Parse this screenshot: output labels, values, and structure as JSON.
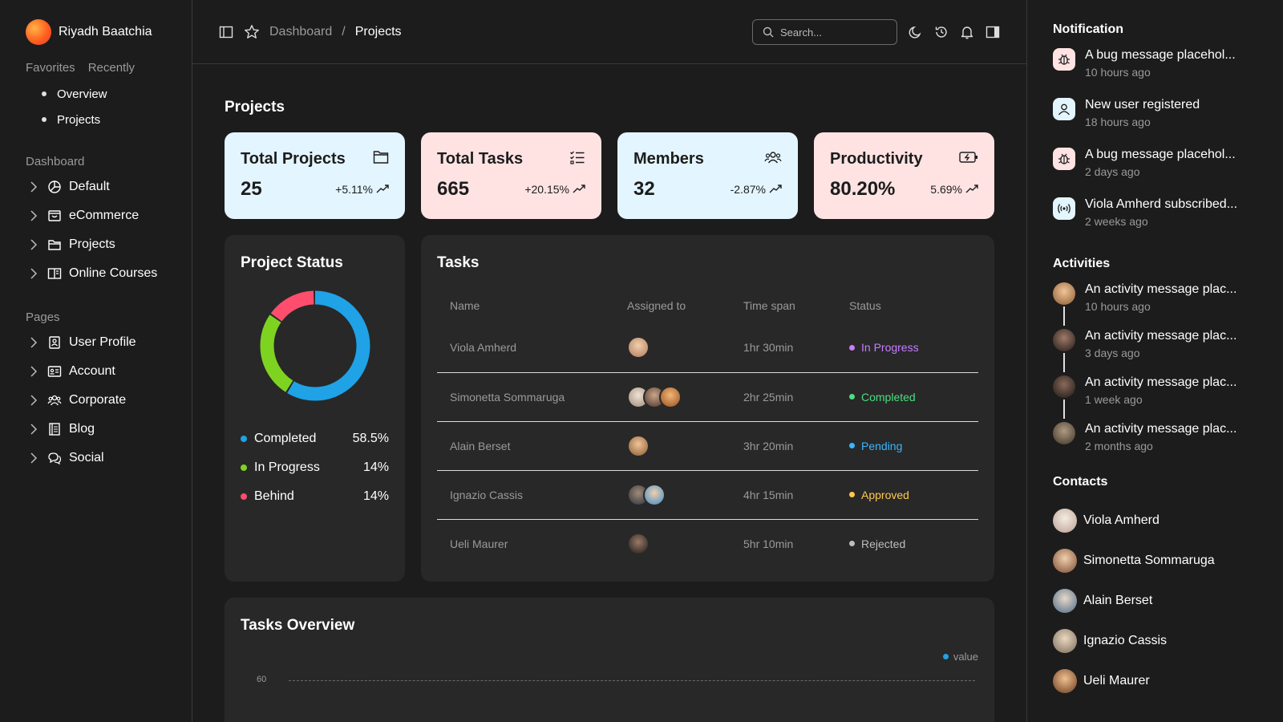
{
  "profile": {
    "name": "Riyadh Baatchia"
  },
  "sidebar": {
    "tabs": [
      "Favorites",
      "Recently"
    ],
    "favorites": [
      {
        "label": "Overview"
      },
      {
        "label": "Projects"
      }
    ],
    "dashboard_title": "Dashboard",
    "dashboard_items": [
      {
        "label": "Default",
        "icon": "pie-chart-icon"
      },
      {
        "label": "eCommerce",
        "icon": "shopping-bag-icon"
      },
      {
        "label": "Projects",
        "icon": "folder-icon"
      },
      {
        "label": "Online Courses",
        "icon": "book-open-icon"
      }
    ],
    "pages_title": "Pages",
    "pages_items": [
      {
        "label": "User Profile",
        "icon": "id-badge-icon"
      },
      {
        "label": "Account",
        "icon": "id-card-icon"
      },
      {
        "label": "Corporate",
        "icon": "users-icon"
      },
      {
        "label": "Blog",
        "icon": "notebook-icon"
      },
      {
        "label": "Social",
        "icon": "chat-icon"
      }
    ]
  },
  "topbar": {
    "breadcrumb": {
      "parent": "Dashboard",
      "separator": "/",
      "current": "Projects"
    },
    "search_placeholder": "Search..."
  },
  "main": {
    "title": "Projects",
    "stats": [
      {
        "title": "Total Projects",
        "value": "25",
        "change": "+5.11%",
        "icon": "folder-icon",
        "color": "#e3f5ff"
      },
      {
        "title": "Total Tasks",
        "value": "665",
        "change": "+20.15%",
        "icon": "checklist-icon",
        "color": "#ffe3e3"
      },
      {
        "title": "Members",
        "value": "32",
        "change": "-2.87%",
        "icon": "users-icon",
        "color": "#e3f5ff"
      },
      {
        "title": "Productivity",
        "value": "80.20%",
        "change": "5.69%",
        "icon": "battery-charging-icon",
        "color": "#ffe3e3"
      }
    ],
    "project_status": {
      "title": "Project Status",
      "items": [
        {
          "label": "Completed",
          "value": "58.5%",
          "color": "#1fa2e6"
        },
        {
          "label": "In Progress",
          "value": "14%",
          "color": "#7ed321"
        },
        {
          "label": "Behind",
          "value": "14%",
          "color": "#ff4d6d"
        }
      ]
    },
    "tasks": {
      "title": "Tasks",
      "columns": [
        "Name",
        "Assigned to",
        "Time span",
        "Status"
      ],
      "rows": [
        {
          "name": "Viola Amherd",
          "assignees": [
            "#d7a37e"
          ],
          "time": "1hr 30min",
          "status": "In Progress",
          "status_color": "#c77dff"
        },
        {
          "name": "Simonetta Sommaruga",
          "assignees": [
            "#d9c2ad",
            "#6b4e3d",
            "#c4732e"
          ],
          "time": "2hr 25min",
          "status": "Completed",
          "status_color": "#4ade80"
        },
        {
          "name": "Alain Berset",
          "assignees": [
            "#c9955f"
          ],
          "time": "3hr 20min",
          "status": "Pending",
          "status_color": "#38b6ff"
        },
        {
          "name": "Ignazio Cassis",
          "assignees": [
            "#3c4a5a",
            "#6fb6e8"
          ],
          "time": "4hr 15min",
          "status": "Approved",
          "status_color": "#ffc94d"
        },
        {
          "name": "Ueli Maurer",
          "assignees": [
            "#4a3a35"
          ],
          "time": "5hr 10min",
          "status": "Rejected",
          "status_color": "#bdbdbd"
        }
      ]
    },
    "overview": {
      "title": "Tasks Overview",
      "legend": "value",
      "axis_value": "60"
    }
  },
  "right": {
    "notification_title": "Notification",
    "notifications": [
      {
        "text": "A bug message placehol...",
        "time": "10 hours ago",
        "icon": "bug-icon",
        "color": "#ffe3e3"
      },
      {
        "text": "New user registered",
        "time": "18 hours ago",
        "icon": "user-icon",
        "color": "#e3f5ff"
      },
      {
        "text": "A bug message placehol...",
        "time": "2 days ago",
        "icon": "bug-icon",
        "color": "#ffe3e3"
      },
      {
        "text": "Viola Amherd subscribed...",
        "time": "2 weeks ago",
        "icon": "broadcast-icon",
        "color": "#e3f5ff"
      }
    ],
    "activities_title": "Activities",
    "activities": [
      {
        "text": "An activity message plac...",
        "time": "10 hours ago",
        "avatar_color": "#c9955f"
      },
      {
        "text": "An activity message plac...",
        "time": "3 days ago",
        "avatar_color": "#3a2e2a"
      },
      {
        "text": "An activity message plac...",
        "time": "1 week ago",
        "avatar_color": "#4a3a35"
      },
      {
        "text": "An activity message plac...",
        "time": "2 months ago",
        "avatar_color": "#6b5a48"
      }
    ],
    "contacts_title": "Contacts",
    "contacts": [
      {
        "name": "Viola Amherd",
        "avatar_color": "#e6d6c8"
      },
      {
        "name": "Simonetta Sommaruga",
        "avatar_color": "#b07a5a"
      },
      {
        "name": "Alain Berset",
        "avatar_color": "#6f8aa0"
      },
      {
        "name": "Ignazio Cassis",
        "avatar_color": "#a8927a"
      },
      {
        "name": "Ueli Maurer",
        "avatar_color": "#8a5a3e"
      }
    ]
  }
}
